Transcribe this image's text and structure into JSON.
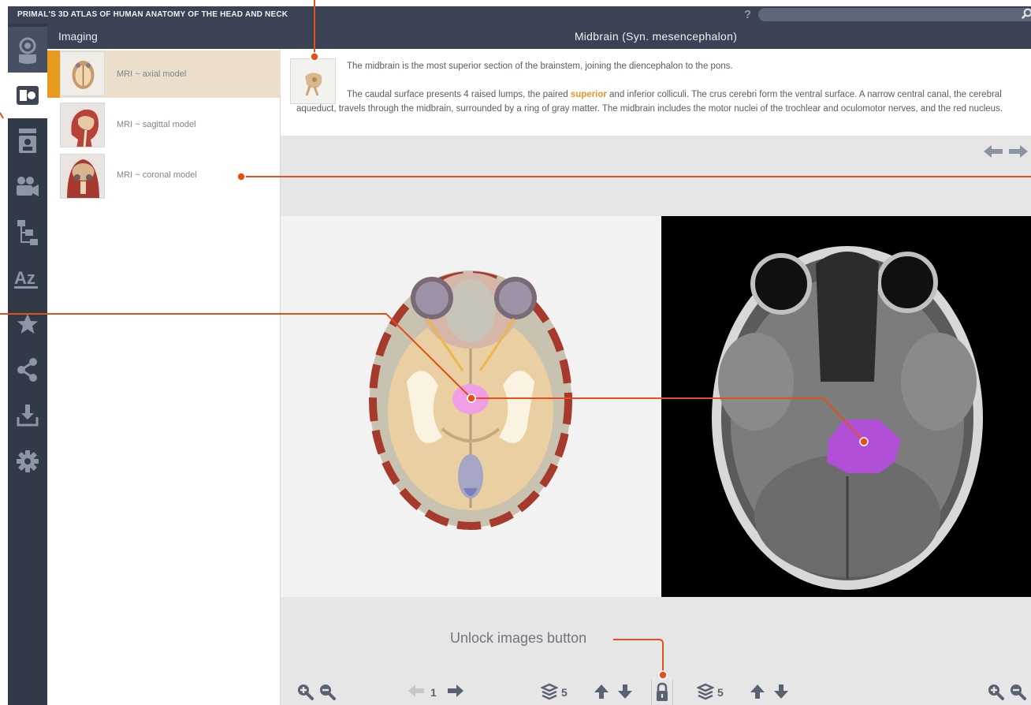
{
  "app": {
    "title": "PRIMAL'S 3D ATLAS OF HUMAN ANATOMY OF THE HEAD AND NECK",
    "help": "?"
  },
  "search": {
    "placeholder": ""
  },
  "sidebar": {
    "header": "Imaging",
    "items": [
      {
        "label": "MRI ~ axial model"
      },
      {
        "label": "MRI ~ sagittal model"
      },
      {
        "label": "MRI ~ coronal model"
      }
    ]
  },
  "iconbar": [
    "model-icon",
    "imaging-icon",
    "slides-icon",
    "movies-icon",
    "hierarchy-icon",
    "index-az-icon",
    "favorites-star-icon",
    "share-icon",
    "download-icon",
    "settings-gear-icon"
  ],
  "content": {
    "title": "Midbrain (Syn. mesencephalon)",
    "para1": "The midbrain is the most superior section of the brainstem, joining the diencephalon to the pons.",
    "para2_a": "The caudal surface presents 4 raised lumps, the paired ",
    "para2_link": "superior",
    "para2_b": " and inferior colliculi. The crus cerebri form the ventral surface. A narrow central canal, the cerebral aqueduct, travels through the midbrain, surrounded by a ring of gray matter. The midbrain includes the motor nuclei of the trochlear and oculomotor nerves, and the red nucleus."
  },
  "callout": {
    "label": "Unlock images button"
  },
  "bottom": {
    "page": "1",
    "layers_left": "5",
    "layers_right": "5"
  },
  "colors": {
    "accent": "#e89a1f",
    "callout": "#e0521a",
    "highlight": "#d36ce8"
  }
}
